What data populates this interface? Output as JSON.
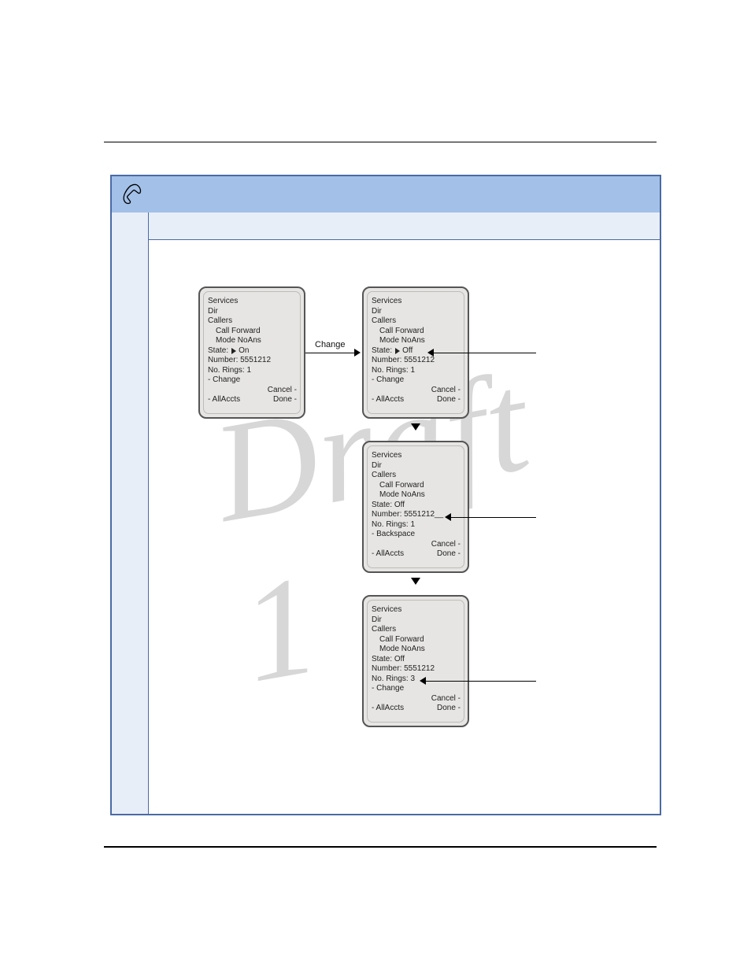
{
  "watermark": "Draft 1",
  "labels": {
    "change": "Change"
  },
  "screens": {
    "a": {
      "line1": "Services",
      "line2": "Dir",
      "line3": "Callers",
      "line4": "Call Forward",
      "line5": "Mode NoAns",
      "line6_prefix": "State:",
      "line6_value": "On",
      "line7": "Number: 5551212",
      "line8": "No. Rings: 1",
      "soft1_left": "- Change",
      "soft1_right": "Cancel -",
      "soft2_left": "- AllAccts",
      "soft2_right": "Done -"
    },
    "b": {
      "line1": "Services",
      "line2": "Dir",
      "line3": "Callers",
      "line4": "Call Forward",
      "line5": "Mode NoAns",
      "line6_prefix": "State:",
      "line6_value": "Off",
      "line7": "Number: 5551212",
      "line8": "No. Rings: 1",
      "soft1_left": "- Change",
      "soft1_right": "Cancel -",
      "soft2_left": "- AllAccts",
      "soft2_right": "Done -"
    },
    "c": {
      "line1": "Services",
      "line2": "Dir",
      "line3": "Callers",
      "line4": "Call Forward",
      "line5": "Mode NoAns",
      "line6": "State:     Off",
      "line7": "Number: 5551212__",
      "line8": "No. Rings: 1",
      "soft1_left": "- Backspace",
      "soft1_right": "Cancel -",
      "soft2_left": "- AllAccts",
      "soft2_right": "Done -"
    },
    "d": {
      "line1": "Services",
      "line2": "Dir",
      "line3": "Callers",
      "line4": "Call Forward",
      "line5": "Mode NoAns",
      "line6": "State:     Off",
      "line7": "Number: 5551212",
      "line8": "No. Rings: 3",
      "soft1_left": "- Change",
      "soft1_right": "Cancel -",
      "soft2_left": "- AllAccts",
      "soft2_right": "Done -"
    }
  }
}
